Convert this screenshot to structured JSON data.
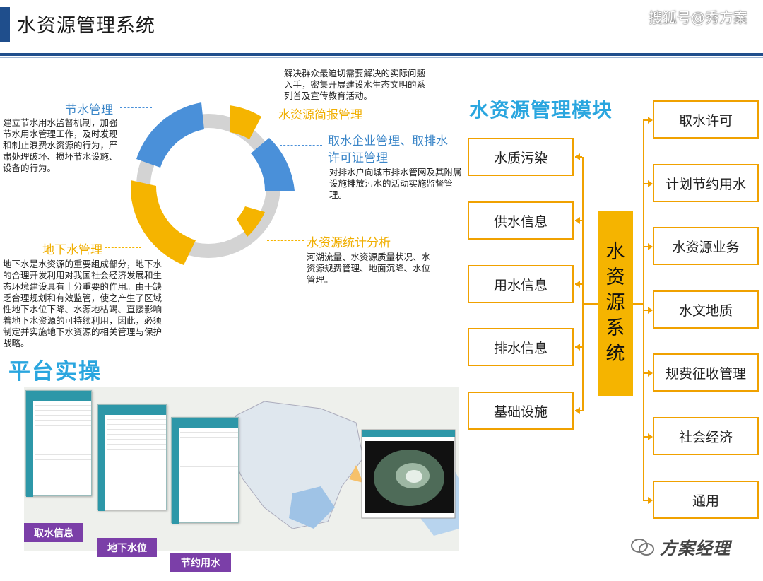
{
  "header": {
    "title": "水资源管理系统",
    "source": "搜狐号@秀方案"
  },
  "ring": {
    "water_saving": {
      "title": "节水管理",
      "desc": "建立节水用水监督机制，加强节水用水管理工作，及时发现和制止浪费水资源的行为，严肃处理破坏、损坏节水设施、设备的行为。"
    },
    "bulletin": {
      "title": "水资源简报管理",
      "desc": "解决群众最迫切需要解决的实际问题入手，密集开展建设水生态文明的系列普及宣传教育活动。"
    },
    "permit": {
      "title": "取水企业管理、取排水许可证管理",
      "desc": "对排水户向城市排水管网及其附属设施排放污水的活动实施监督管理。"
    },
    "stats": {
      "title": "水资源统计分析",
      "desc": "河湖流量、水资源质量状况、水资源规费管理、地面沉降、水位管理。"
    },
    "groundwater": {
      "title": "地下水管理",
      "desc": "地下水是水资源的重要组成部分，地下水的合理开发利用对我国社会经济发展和生态环境建设具有十分重要的作用。由于缺乏合理规划和有效监管，使之产生了区域性地下水位下降、水源地枯竭、直接影响着地下水资源的可持续利用，因此，必须制定并实施地下水资源的相关管理与保护战略。"
    }
  },
  "module": {
    "title": "水资源管理模块",
    "center": [
      "水",
      "资",
      "源",
      "系",
      "统"
    ],
    "left": [
      "水质污染",
      "供水信息",
      "用水信息",
      "排水信息",
      "基础设施"
    ],
    "right": [
      "取水许可",
      "计划节约用水",
      "水资源业务",
      "水文地质",
      "规费征收管理",
      "社会经济",
      "通用"
    ]
  },
  "platform": {
    "title": "平台实操",
    "tags": [
      "取水信息",
      "地下水位",
      "节约用水"
    ]
  },
  "watermark": "方案经理",
  "colors": {
    "blue": "#4a90d9",
    "gold": "#f5b400",
    "gray": "#d3d3d3",
    "module_title": "#2aa6df",
    "tag": "#7b3fa8"
  }
}
